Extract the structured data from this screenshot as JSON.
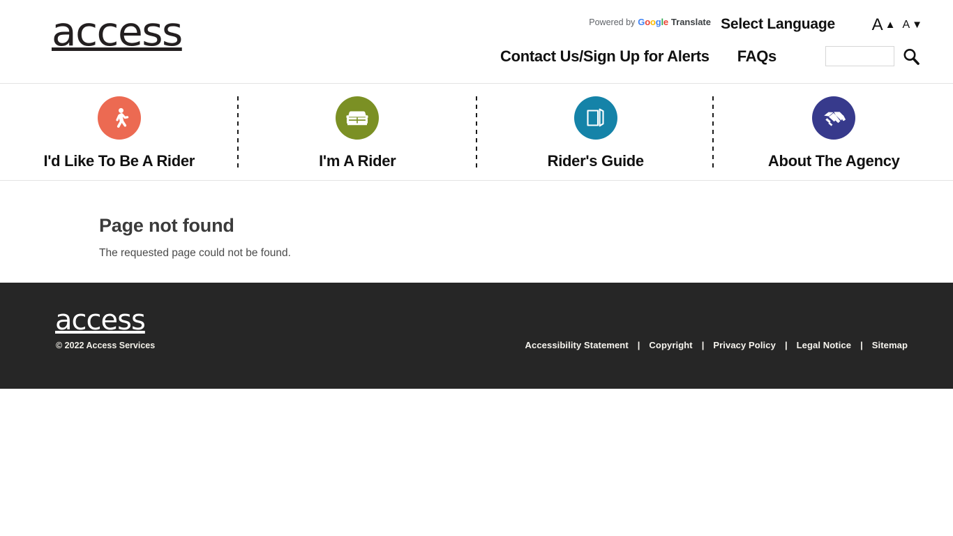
{
  "header": {
    "logo_text": "access",
    "translate": {
      "powered_by": "Powered by",
      "google": "Google",
      "google_letters": [
        "G",
        "o",
        "o",
        "g",
        "l",
        "e"
      ],
      "translate": "Translate"
    },
    "select_language": "Select Language",
    "text_size": {
      "increase_label": "A",
      "increase_icon": "▲",
      "decrease_label": "A",
      "decrease_icon": "▼"
    },
    "nav": [
      {
        "label": "Contact Us/Sign Up for Alerts"
      },
      {
        "label": "FAQs"
      }
    ],
    "search": {
      "value": "",
      "placeholder": "",
      "icon": "search-icon"
    }
  },
  "category_nav": {
    "items": [
      {
        "label": "I'd Like To Be A Rider",
        "icon": "pedestrian-icon",
        "color": "#ec6a52"
      },
      {
        "label": "I'm A Rider",
        "icon": "vehicle-icon",
        "color": "#7b9024"
      },
      {
        "label": "Rider's Guide",
        "icon": "book-icon",
        "color": "#1583a8"
      },
      {
        "label": "About The Agency",
        "icon": "handshake-icon",
        "color": "#373a8c"
      }
    ]
  },
  "main": {
    "title": "Page not found",
    "body": "The requested page could not be found."
  },
  "footer": {
    "logo_text": "access",
    "copyright": "© 2022 Access Services",
    "separator": "|",
    "links": [
      {
        "label": "Accessibility Statement"
      },
      {
        "label": "Copyright"
      },
      {
        "label": "Privacy Policy"
      },
      {
        "label": "Legal Notice"
      },
      {
        "label": "Sitemap"
      }
    ]
  },
  "colors": {
    "footer_bg": "#262626",
    "page_bg": "#ffffff",
    "rider_orange": "#ec6a52",
    "rider_green": "#7b9024",
    "guide_teal": "#1583a8",
    "agency_indigo": "#373a8c"
  }
}
